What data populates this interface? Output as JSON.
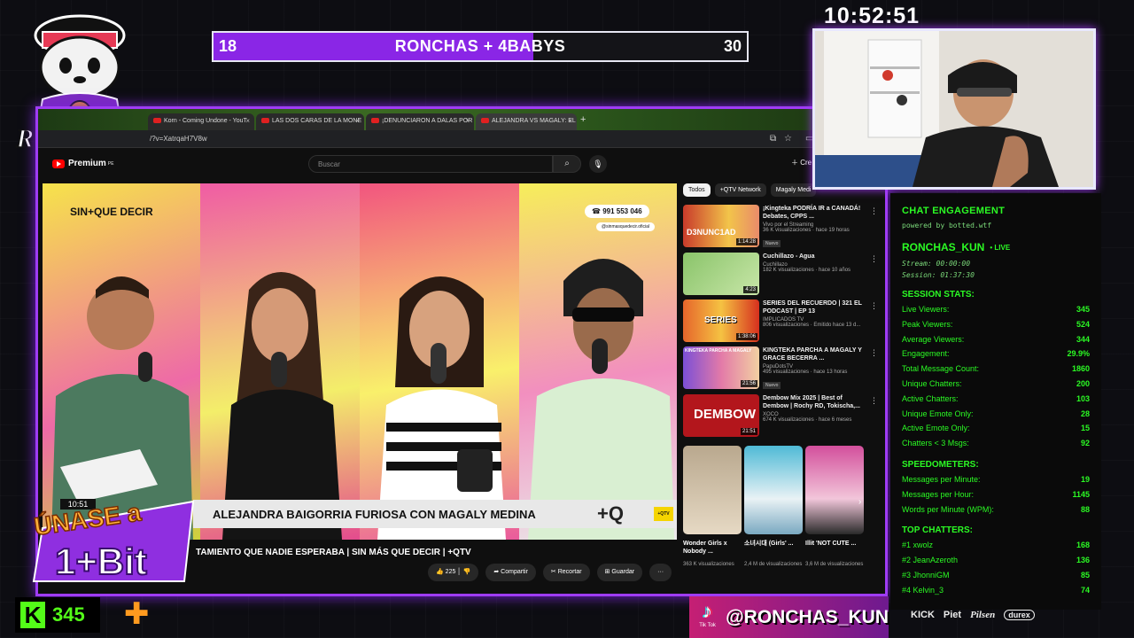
{
  "clock": "10:52:51",
  "scoreboard": {
    "left_score": "18",
    "title": "RONCHAS + 4BABYS",
    "right_score": "30",
    "fill_percent": 60,
    "fill_color": "#8a26e6"
  },
  "logo": {
    "text": "RONCHAS"
  },
  "browser": {
    "tabs": [
      {
        "label": "Korn - Coming Undone - YouT"
      },
      {
        "label": "LAS DOS CARAS DE LA MONE"
      },
      {
        "label": "¡DENUNCIARON A DALAS POR"
      },
      {
        "label": "ALEJANDRA VS MAGALY: EL"
      }
    ],
    "add_tab": "+",
    "url": "/?v=XatrqaH7V8w",
    "youtube": {
      "logo": "Premium",
      "region": "PE",
      "search_placeholder": "Buscar",
      "create": "Cre"
    }
  },
  "video": {
    "brand_top": "SIN+QUE DECIR",
    "phone": "991 553 046",
    "handle": "@sinmasquedecir.oficial",
    "chyron": "ALEJANDRA BAIGORRIA FURIOSA CON MAGALY MEDINA",
    "chyron_tag": "+QTV",
    "timestamp": "10:51",
    "title": "TAMIENTO QUE NADIE ESPERABA | SIN MÁS QUE DECIR | +QTV",
    "likes": "225",
    "share": "Compartir",
    "clip": "Recortar",
    "save": "Guardar",
    "more": "···"
  },
  "sidebar": {
    "chips": [
      "Todos",
      "+QTV Network",
      "Magaly Medi"
    ],
    "recommendations": [
      {
        "title": "¡Kingteka PODRÍA IR a CANADÁ! Debates, CPPS ...",
        "channel": "Vivo por el Streaming",
        "meta": "36 K visualizaciones · hace 19 horas",
        "badge": "Nuevo",
        "duration": "1:14:28",
        "thumb_text": "D3NUNC1AD"
      },
      {
        "title": "Cuchillazo - Agua",
        "channel": "Cuchillazo",
        "meta": "182 K visualizaciones · hace 10 años",
        "badge": "",
        "duration": "4:23",
        "thumb_text": ""
      },
      {
        "title": "SERIES DEL RECUERDO | 321 EL PODCAST | EP 13",
        "channel": "IMPLICADOS TV",
        "meta": "806 visualizaciones · Emitido hace 13 d...",
        "badge": "",
        "duration": "1:38:06",
        "thumb_text": "SERIES"
      },
      {
        "title": "KINGTEKA PARCHA A MAGALY Y GRACE BECERRA ...",
        "channel": "PapuDotsTV",
        "meta": "495 visualizaciones · hace 13 horas",
        "badge": "Nuevo",
        "duration": "21:56",
        "thumb_text": "KINGTEKA PARCHA A MAGALY"
      },
      {
        "title": "Dembow Mix 2025 | Best of Dembow | Rochy RD, Tokischa,...",
        "channel": "XOCO",
        "meta": "674 K visualizaciones · hace 6 meses",
        "badge": "",
        "duration": "21:51",
        "thumb_text": "DEMBOW"
      }
    ],
    "shorts": [
      {
        "title": "Wonder Girls x Nobody ...",
        "views": "363 K visualizaciones"
      },
      {
        "title": "소녀시대 (Girls' ...",
        "views": "2,4 M de visualizaciones"
      },
      {
        "title": "Illit 'NOT CUTE ...",
        "views": "3,6 M de visualizaciones"
      }
    ]
  },
  "stats": {
    "heading": "CHAT ENGAGEMENT",
    "powered": "powered by botted.wtf",
    "user": "RONCHAS_KUN",
    "live": "• LIVE",
    "stream": "Stream: 00:00:00",
    "session": "Session: 01:37:30",
    "session_heading": "SESSION STATS:",
    "session_rows": [
      {
        "label": "Live Viewers:",
        "value": "345"
      },
      {
        "label": "Peak Viewers:",
        "value": "524"
      },
      {
        "label": "Average Viewers:",
        "value": "344"
      },
      {
        "label": "Engagement:",
        "value": "29.9%"
      },
      {
        "label": "Total Message Count:",
        "value": "1860"
      },
      {
        "label": "Unique Chatters:",
        "value": "200"
      },
      {
        "label": "Active Chatters:",
        "value": "103"
      },
      {
        "label": "Unique Emote Only:",
        "value": "28"
      },
      {
        "label": "Active Emote Only:",
        "value": "15"
      },
      {
        "label": "Chatters < 3 Msgs:",
        "value": "92"
      }
    ],
    "speed_heading": "SPEEDOMETERS:",
    "speed_rows": [
      {
        "label": "Messages per Minute:",
        "value": "19"
      },
      {
        "label": "Messages per Hour:",
        "value": "1145"
      },
      {
        "label": "Words per Minute (WPM):",
        "value": "88"
      }
    ],
    "top_heading": "TOP CHATTERS:",
    "top_rows": [
      {
        "label": "#1 xwolz",
        "value": "168"
      },
      {
        "label": "#2 JeanAzeroth",
        "value": "136"
      },
      {
        "label": "#3 JhonniGM",
        "value": "85"
      },
      {
        "label": "#4 Kelvin_3",
        "value": "74"
      }
    ]
  },
  "kick": {
    "logo": "K",
    "viewers": "345",
    "accent": "#53fc18"
  },
  "promo": {
    "line1": "ÚNASE a",
    "line2": "1+Bit"
  },
  "tiktok": {
    "handle": "@RONCHAS_KUN",
    "label": "Tik Tok"
  },
  "sponsors": [
    "KICK",
    "Piet",
    "Pilsen",
    "durex"
  ]
}
